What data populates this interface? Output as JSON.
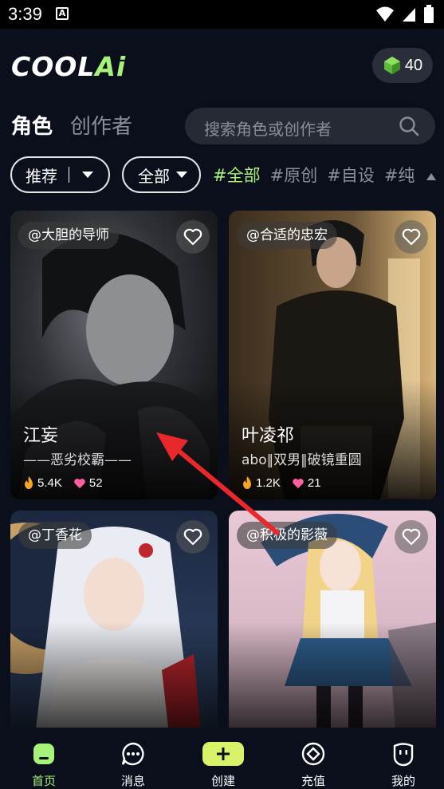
{
  "status_bar": {
    "time": "3:39",
    "notif_icon": "a-icon",
    "icons": [
      "wifi-icon",
      "signal-icon",
      "battery-icon"
    ]
  },
  "header": {
    "logo_main": "COOL",
    "logo_accent": "Ai",
    "coins": "40",
    "coin_icon": "green-gem-icon"
  },
  "tabs": {
    "active": "角色",
    "inactive": "创作者"
  },
  "search": {
    "placeholder": "搜索角色或创作者",
    "icon": "search-icon"
  },
  "filters": {
    "recommend": "推荐",
    "all": "全部",
    "hashtags": [
      "#全部",
      "#原创",
      "#自设",
      "#纯"
    ]
  },
  "cards": [
    {
      "creator": "@大胆的导师",
      "name": "江妄",
      "tagline": "——恶劣校霸——",
      "heat": "5.4K",
      "likes": "52"
    },
    {
      "creator": "@合适的忠宏",
      "name": "叶凌祁",
      "tagline": "abo‖双男‖破镜重圆",
      "heat": "1.2K",
      "likes": "21"
    },
    {
      "creator": "@丁香花",
      "name": "",
      "tagline": "",
      "heat": "",
      "likes": ""
    },
    {
      "creator": "@积极的影薇",
      "name": "",
      "tagline": "",
      "heat": "",
      "likes": ""
    }
  ],
  "bottom_nav": [
    {
      "label": "首页",
      "icon": "home-icon",
      "active": true
    },
    {
      "label": "消息",
      "icon": "message-icon",
      "active": false
    },
    {
      "label": "创建",
      "icon": "create-plus-icon",
      "active": false
    },
    {
      "label": "充值",
      "icon": "recharge-icon",
      "active": false
    },
    {
      "label": "我的",
      "icon": "profile-icon",
      "active": false
    }
  ],
  "colors": {
    "accent": "#a6f27a",
    "background": "#0b0f1c",
    "annotation_arrow": "#e8282b"
  }
}
